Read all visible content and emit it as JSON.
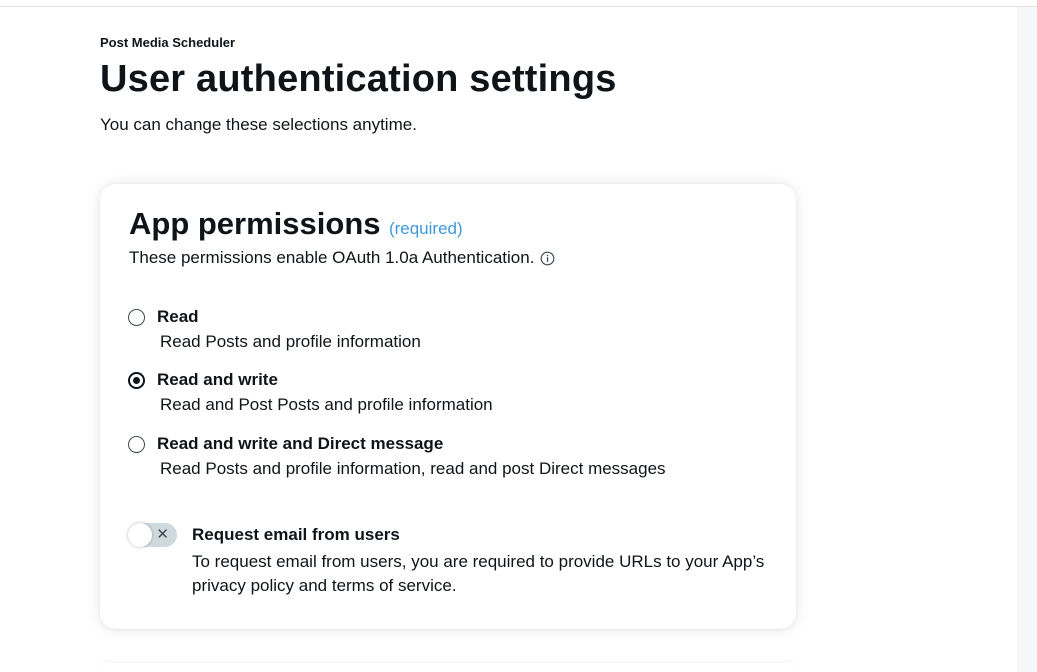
{
  "header": {
    "app_name": "Post Media Scheduler",
    "title": "User authentication settings",
    "subtitle": "You can change these selections anytime."
  },
  "permissions": {
    "title": "App permissions",
    "required_tag": "(required)",
    "description": "These permissions enable OAuth 1.0a Authentication.",
    "info_icon": "info-circle-icon",
    "selected": "Read and write",
    "options": [
      {
        "label": "Read",
        "description": "Read Posts and profile information",
        "checked": false
      },
      {
        "label": "Read and write",
        "description": "Read and Post Posts and profile information",
        "checked": true
      },
      {
        "label": "Read and write and Direct message",
        "description": "Read Posts and profile information, read and post Direct messages",
        "checked": false
      }
    ]
  },
  "email_request": {
    "enabled": false,
    "toggle_icon": "close-icon",
    "title": "Request email from users",
    "description": "To request email from users, you are required to provide URLs to your App’s privacy policy and terms of service."
  },
  "colors": {
    "accent": "#3d9ae0",
    "text": "#0f1419",
    "toggle_off": "#cfd9de"
  }
}
